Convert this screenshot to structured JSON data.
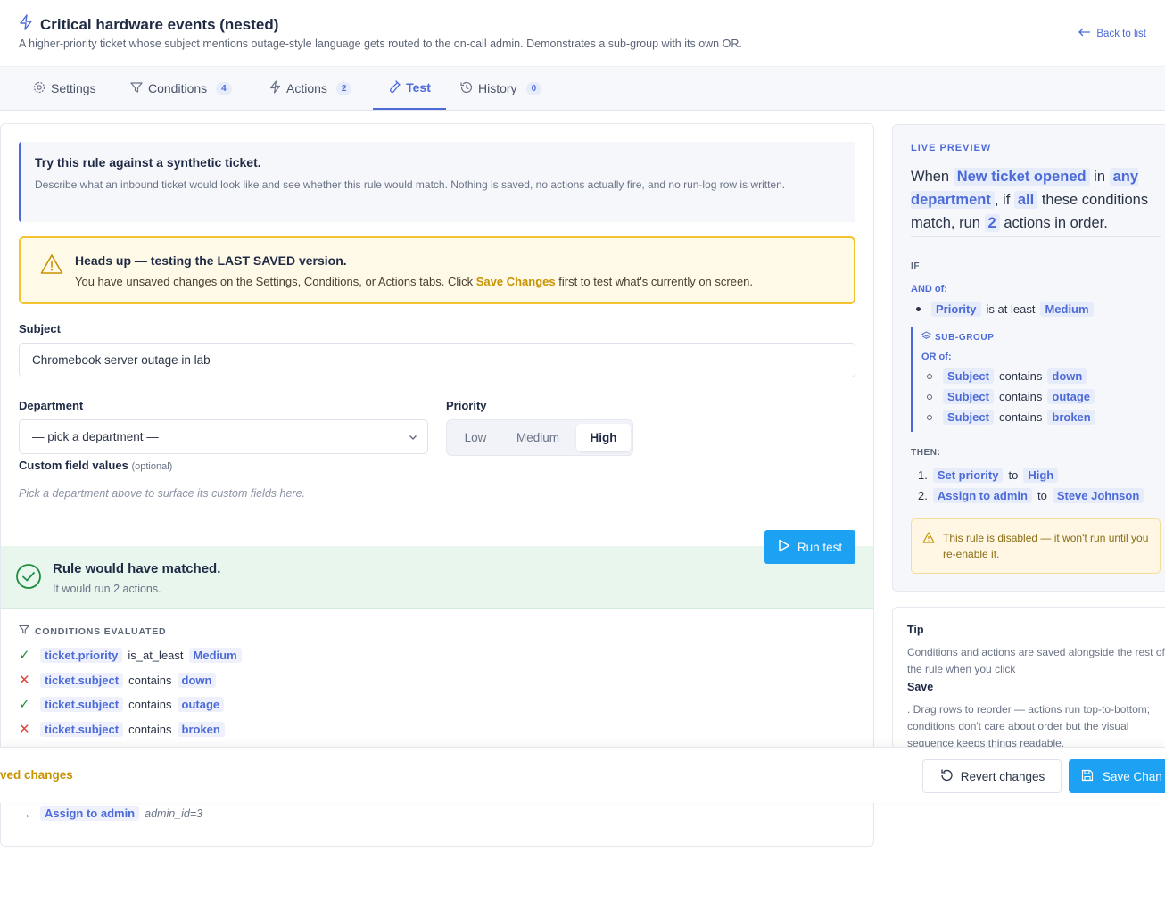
{
  "header": {
    "title": "Critical hardware events (nested)",
    "subtitle": "A higher-priority ticket whose subject mentions outage-style language gets routed to the on-call admin. Demonstrates a sub-group with its own OR.",
    "back_label": "Back to list"
  },
  "tabs": [
    {
      "label": "Settings",
      "count": ""
    },
    {
      "label": "Conditions",
      "count": "4"
    },
    {
      "label": "Actions",
      "count": "2"
    },
    {
      "label": "Test",
      "count": ""
    },
    {
      "label": "History",
      "count": "0"
    }
  ],
  "intro": {
    "title": "Try this rule against a synthetic ticket.",
    "text": "Describe what an inbound ticket would look like and see whether this rule would match. Nothing is saved, no actions actually fire, and no run-log row is written."
  },
  "warning": {
    "title": "Heads up — testing the LAST SAVED version.",
    "text_before": "You have unsaved changes on the Settings, Conditions, or Actions tabs. Click ",
    "text_bold": "Save Changes",
    "text_after": " first to test what's currently on screen."
  },
  "form": {
    "subject_label": "Subject",
    "subject_value": "Chromebook server outage in lab",
    "department_label": "Department",
    "department_value": "— pick a department —",
    "priority_label": "Priority",
    "priority_options": [
      "Low",
      "Medium",
      "High"
    ],
    "priority_selected": "High",
    "custom_label": "Custom field values",
    "custom_optional": "(optional)",
    "custom_hint": "Pick a department above to surface its custom fields here.",
    "run_label": "Run test"
  },
  "result": {
    "title": "Rule would have matched.",
    "subtitle": "It would run 2 actions."
  },
  "conditions": {
    "heading": "CONDITIONS EVALUATED",
    "rows": [
      {
        "passed": "✓",
        "field": "ticket.priority",
        "op": "is_at_least",
        "value": "Medium"
      },
      {
        "passed": "✕",
        "field": "ticket.subject",
        "op": "contains",
        "value": "down"
      },
      {
        "passed": "✓",
        "field": "ticket.subject",
        "op": "contains",
        "value": "outage"
      },
      {
        "passed": "✕",
        "field": "ticket.subject",
        "op": "contains",
        "value": "broken"
      }
    ]
  },
  "actions_run": [
    {
      "name": "Assign to admin",
      "param": "admin_id=3"
    }
  ],
  "preview": {
    "heading": "LIVE PREVIEW",
    "w1": "When",
    "trigger": "New ticket opened",
    "w2": "in",
    "dept": "any department",
    "w3": ", if",
    "mode": "all",
    "w4": "these conditions match, run",
    "count": "2",
    "w5": "actions in order.",
    "if_label": "IF",
    "and_label": "AND of:",
    "top_cond": {
      "field": "Priority",
      "op": "is at least",
      "value": "Medium"
    },
    "subgroup_label": "SUB-GROUP",
    "or_label": "OR of:",
    "sub_conds": [
      {
        "field": "Subject",
        "op": "contains",
        "value": "down"
      },
      {
        "field": "Subject",
        "op": "contains",
        "value": "outage"
      },
      {
        "field": "Subject",
        "op": "contains",
        "value": "broken"
      }
    ],
    "then_label": "THEN:",
    "actions": [
      {
        "num": "1.",
        "name": "Set priority",
        "to": "to",
        "value": "High"
      },
      {
        "num": "2.",
        "name": "Assign to admin",
        "to": "to",
        "value": "Steve Johnson"
      }
    ],
    "disabled_note": "This rule is disabled — it won't run until you re-enable it."
  },
  "tip": {
    "title": "Tip",
    "text1": "Conditions and actions are saved alongside the rest of the rule when you click",
    "bold": "Save",
    "text2": ". Drag rows to reorder — actions run top-to-bottom; conditions don't care about order but the visual sequence keeps things readable."
  },
  "footer": {
    "unsaved": "ved changes",
    "revert_label": "Revert changes",
    "save_label": "Save Chan"
  },
  "colors": {
    "accent": "#4c6bd8",
    "primary_button": "#1da1f2",
    "warning": "#f2c230",
    "success": "#1e8e3e",
    "error": "#e0453a"
  }
}
